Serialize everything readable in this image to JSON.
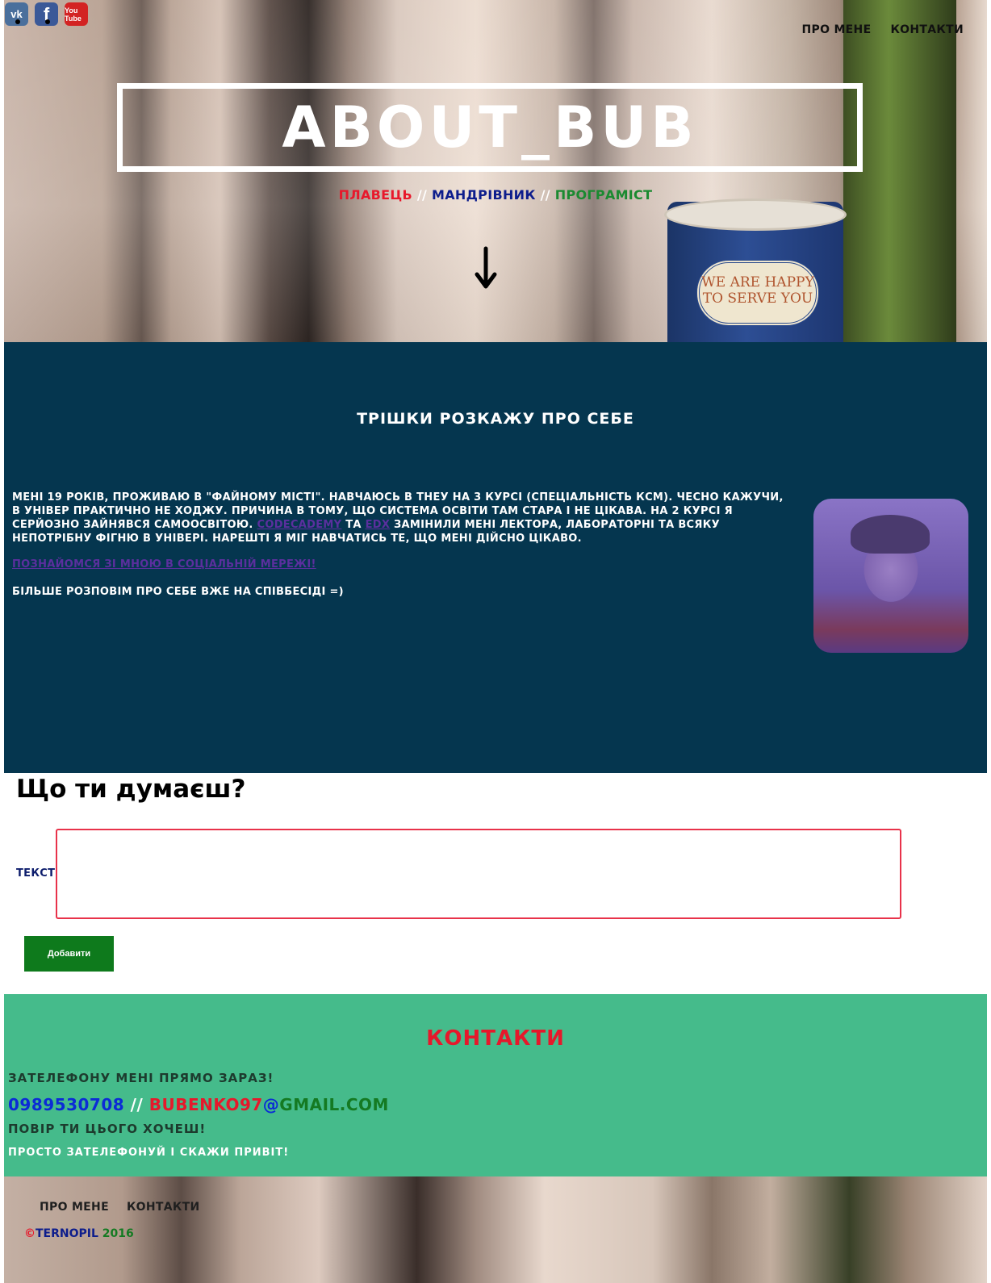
{
  "social": {
    "items": [
      {
        "name": "vk",
        "glyph": "vk"
      },
      {
        "name": "facebook",
        "glyph": "f"
      },
      {
        "name": "youtube",
        "glyph": "You Tube"
      }
    ]
  },
  "nav": {
    "about": "ПРО МЕНЕ",
    "contacts": "КОНТАКТИ"
  },
  "hero": {
    "title": "ABOUT_BUB",
    "role1": "ПЛАВЕЦЬ",
    "sep": " // ",
    "role2": "МАНДРІВНИК",
    "role3": "ПРОГРАМІСТ",
    "cup_text": "WE ARE HAPPY TO SERVE YOU"
  },
  "about": {
    "heading": "ТРІШКИ РОЗКАЖУ ПРО СЕБЕ",
    "text_part1": "МЕНІ 19 РОКІВ, ПРОЖИВАЮ В \"ФАЙНОМУ МІСТІ\". НАВЧАЮСЬ В ТНЕУ НА 3 КУРСІ (СПЕЦІАЛЬНІСТЬ КСМ). ЧЕСНО КАЖУЧИ, В УНІВЕР ПРАКТИЧНО НЕ ХОДЖУ. ПРИЧИНА В ТОМУ, ЩО СИСТЕМА ОСВІТИ ТАМ СТАРА І НЕ ЦІКАВА. НА 2 КУРСІ Я СЕРЙОЗНО ЗАЙНЯВСЯ САМООСВІТОЮ. ",
    "link_codecademy": "CODECADEMY",
    "text_and": " ТА ",
    "link_edx": "EDX",
    "text_part2": " ЗАМІНИЛИ МЕНІ ЛЕКТОРА, ЛАБОРАТОРНІ ТА ВСЯКУ НЕПОТРІБНУ ФІГНЮ В УНІВЕРІ. НАРЕШТІ Я МІГ НАВЧАТИСЬ ТЕ, ЩО МЕНІ ДІЙСНО ЦІКАВО.",
    "social_link": "ПОЗНАЙОМСЯ ЗІ МНОЮ В СОЦІАЛЬНІЙ МЕРЕЖІ!",
    "closing": "БІЛЬШЕ РОЗПОВІМ ПРО СЕБЕ ВЖЕ НА СПІВБЕСІДІ =)"
  },
  "form": {
    "heading": "Що ти думаєш?",
    "label": "ТЕКСТ",
    "textarea_value": "",
    "button": "Добавити"
  },
  "contacts": {
    "heading": "КОНТАКТИ",
    "line1": "ЗАТЕЛЕФОНУ МЕНІ ПРЯМО ЗАРАЗ!",
    "phone": "0989530708",
    "sep": " // ",
    "email_user": "BUBENKO97",
    "email_at": "@",
    "email_domain": "GMAIL.COM",
    "line3": "ПОВІР ТИ ЦЬОГО ХОЧЕШ!",
    "line4": "ПРОСТО ЗАТЕЛЕФОНУЙ І СКАЖИ ПРИВІТ!"
  },
  "footer": {
    "about": "ПРО МЕНЕ",
    "contacts": "КОНТАКТИ",
    "copy_sign": "©",
    "city": "TERNOPIL",
    "year": " 2016"
  },
  "colors": {
    "about_bg": "#05364f",
    "contacts_bg": "#45bb8b",
    "accent_red": "#e6182b",
    "accent_blue": "#0d1d8c",
    "accent_green": "#147a22",
    "button_green": "#0e7a1c"
  }
}
